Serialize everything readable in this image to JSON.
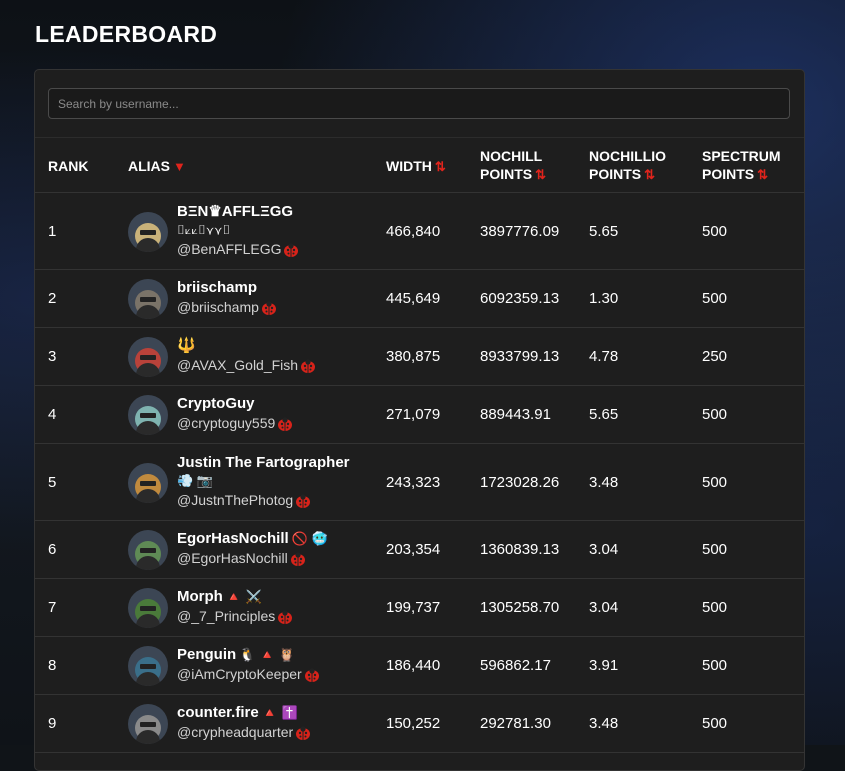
{
  "page": {
    "title": "LEADERBOARD"
  },
  "search": {
    "placeholder": "Search by username..."
  },
  "table": {
    "headers": {
      "rank": "RANK",
      "alias": "ALIAS",
      "alias_sort": "▼",
      "width": "WIDTH",
      "nochill_l1": "NOCHILL",
      "nochill_l2": "POINTS",
      "nochillio_l1": "NOCHILLIO",
      "nochillio_l2": "POINTS",
      "spectrum_l1": "SPECTRUM",
      "spectrum_l2": "POINTS",
      "sort_icon": "⇅"
    },
    "rows": [
      {
        "rank": "1",
        "name": "BΞN♛AFFLΞGG",
        "name_extra": "⌷⟀⟀⌷⋎⋎⌷",
        "handle": "@BenAFFLEGG",
        "width": "466,840",
        "nochill": "3897776.09",
        "nochillio": "5.65",
        "spectrum": "500",
        "avatar_color": "#c9b27a"
      },
      {
        "rank": "2",
        "name": "briischamp",
        "name_extra": "",
        "handle": "@briischamp",
        "width": "445,649",
        "nochill": "6092359.13",
        "nochillio": "1.30",
        "spectrum": "500",
        "avatar_color": "#7a7368"
      },
      {
        "rank": "3",
        "name": "🔱",
        "name_extra": "",
        "handle": "@AVAX_Gold_Fish",
        "width": "380,875",
        "nochill": "8933799.13",
        "nochillio": "4.78",
        "spectrum": "250",
        "avatar_color": "#b8423a"
      },
      {
        "rank": "4",
        "name": "CryptoGuy",
        "name_extra": "",
        "handle": "@cryptoguy559",
        "width": "271,079",
        "nochill": "889443.91",
        "nochillio": "5.65",
        "spectrum": "500",
        "avatar_color": "#7fb3b0"
      },
      {
        "rank": "5",
        "name": "Justin The Fartographer",
        "name_extra": "💨 📷",
        "handle": "@JustnThePhotog",
        "width": "243,323",
        "nochill": "1723028.26",
        "nochillio": "3.48",
        "spectrum": "500",
        "avatar_color": "#c08a3e"
      },
      {
        "rank": "6",
        "name": "EgorHasNochill",
        "name_extra": "🚫 🥶",
        "handle": "@EgorHasNochill",
        "width": "203,354",
        "nochill": "1360839.13",
        "nochillio": "3.04",
        "spectrum": "500",
        "avatar_color": "#5f8a55"
      },
      {
        "rank": "7",
        "name": "Morph",
        "name_extra": "🔺 ⚔️",
        "handle": "@_7_Principles",
        "width": "199,737",
        "nochill": "1305258.70",
        "nochillio": "3.04",
        "spectrum": "500",
        "avatar_color": "#4a7a3a"
      },
      {
        "rank": "8",
        "name": "Penguin",
        "name_extra": "🐧 🔺 🦉",
        "handle": "@iAmCryptoKeeper",
        "width": "186,440",
        "nochill": "596862.17",
        "nochillio": "3.91",
        "spectrum": "500",
        "avatar_color": "#3a6f8a"
      },
      {
        "rank": "9",
        "name": "counter.fire",
        "name_extra": "🔺 ✝️",
        "handle": "@crypheadquarter",
        "width": "150,252",
        "nochill": "292781.30",
        "nochillio": "3.48",
        "spectrum": "500",
        "avatar_color": "#8a8a8a"
      }
    ]
  },
  "icons": {
    "verified_badge": "ladybug-badge-icon",
    "sort": "sort-arrows-icon",
    "sort_desc": "caret-down-icon"
  },
  "colors": {
    "accent": "#e0241c",
    "card_bg": "#1e1e1e",
    "page_bg": "#101418"
  }
}
